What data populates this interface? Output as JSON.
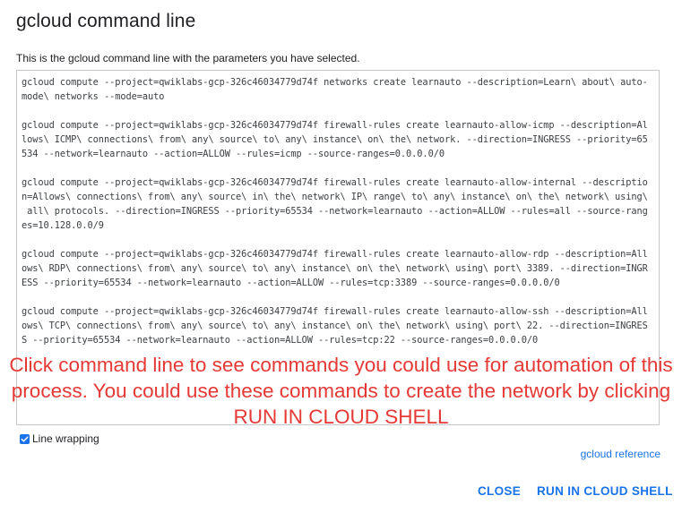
{
  "dialog": {
    "title": "gcloud command line",
    "subtitle": "This is the gcloud command line with the parameters you have selected.",
    "command_lines": [
      "gcloud compute --project=qwiklabs-gcp-326c46034779d74f networks create learnauto --description=Learn\\ about\\ auto-",
      "mode\\ networks --mode=auto",
      "",
      "gcloud compute --project=qwiklabs-gcp-326c46034779d74f firewall-rules create learnauto-allow-icmp --description=Al",
      "lows\\ ICMP\\ connections\\ from\\ any\\ source\\ to\\ any\\ instance\\ on\\ the\\ network. --direction=INGRESS --priority=65",
      "534 --network=learnauto --action=ALLOW --rules=icmp --source-ranges=0.0.0.0/0",
      "",
      "gcloud compute --project=qwiklabs-gcp-326c46034779d74f firewall-rules create learnauto-allow-internal --descriptio",
      "n=Allows\\ connections\\ from\\ any\\ source\\ in\\ the\\ network\\ IP\\ range\\ to\\ any\\ instance\\ on\\ the\\ network\\ using\\",
      " all\\ protocols. --direction=INGRESS --priority=65534 --network=learnauto --action=ALLOW --rules=all --source-rang",
      "es=10.128.0.0/9",
      "",
      "gcloud compute --project=qwiklabs-gcp-326c46034779d74f firewall-rules create learnauto-allow-rdp --description=All",
      "ows\\ RDP\\ connections\\ from\\ any\\ source\\ to\\ any\\ instance\\ on\\ the\\ network\\ using\\ port\\ 3389. --direction=INGR",
      "ESS --priority=65534 --network=learnauto --action=ALLOW --rules=tcp:3389 --source-ranges=0.0.0.0/0",
      "",
      "gcloud compute --project=qwiklabs-gcp-326c46034779d74f firewall-rules create learnauto-allow-ssh --description=All",
      "ows\\ TCP\\ connections\\ from\\ any\\ source\\ to\\ any\\ instance\\ on\\ the\\ network\\ using\\ port\\ 22. --direction=INGRES",
      "S --priority=65534 --network=learnauto --action=ALLOW --rules=tcp:22 --source-ranges=0.0.0.0/0"
    ],
    "overlay_note": "Click command line to see commands you could use for automation of this process. You could use these commands to create the network by clicking RUN IN CLOUD SHELL",
    "line_wrapping": {
      "label": "Line wrapping",
      "checked": true
    },
    "reference_link": "gcloud reference",
    "buttons": {
      "close": "CLOSE",
      "run": "RUN IN CLOUD SHELL"
    }
  },
  "colors": {
    "accent": "#1a73e8",
    "overlay_text": "#e53935",
    "border": "#c8c8c8"
  },
  "icons": {
    "checkbox": "checkmark-icon"
  }
}
